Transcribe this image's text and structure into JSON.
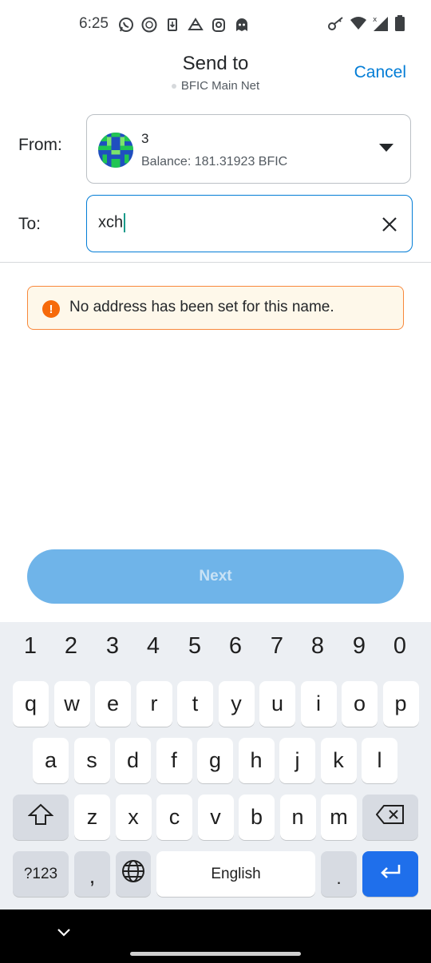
{
  "status_bar": {
    "time": "6:25",
    "left_icons": [
      "whatsapp-icon",
      "badge-icon",
      "download-icon",
      "drive-icon",
      "threads-icon",
      "ghost-icon"
    ],
    "right_icons": [
      "vpn-key-icon",
      "wifi-icon",
      "signal-icon",
      "battery-icon"
    ]
  },
  "header": {
    "title": "Send to",
    "network": "BFIC Main Net",
    "cancel_label": "Cancel"
  },
  "from": {
    "label": "From:",
    "account_name": "3",
    "balance": "Balance: 181.31923 BFIC"
  },
  "to": {
    "label": "To:",
    "value": "xch"
  },
  "warning": {
    "text": "No address has been set for this name."
  },
  "next_label": "Next",
  "keyboard": {
    "numbers": [
      "1",
      "2",
      "3",
      "4",
      "5",
      "6",
      "7",
      "8",
      "9",
      "0"
    ],
    "row1": [
      "q",
      "w",
      "e",
      "r",
      "t",
      "y",
      "u",
      "i",
      "o",
      "p"
    ],
    "row2": [
      "a",
      "s",
      "d",
      "f",
      "g",
      "h",
      "j",
      "k",
      "l"
    ],
    "row3": [
      "z",
      "x",
      "c",
      "v",
      "b",
      "n",
      "m"
    ],
    "symbols_label": "?123",
    "comma": ",",
    "space_label": "English",
    "period": "."
  },
  "colors": {
    "accent": "#037dd6",
    "warning_border": "#f8883b",
    "next_button": "#6fb4e9",
    "enter_key": "#1f6feb"
  }
}
